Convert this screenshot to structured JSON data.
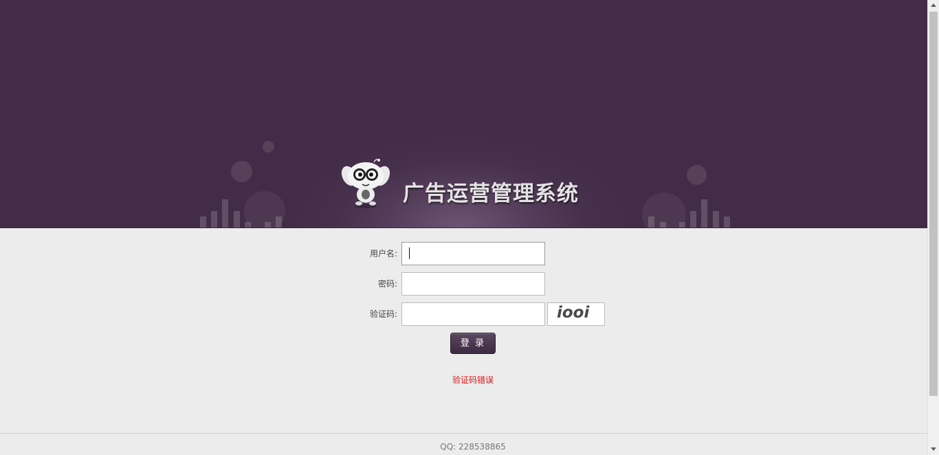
{
  "header": {
    "title": "广告运营管理系统",
    "logo_icon": "cartoon-mascot-icon"
  },
  "login_form": {
    "username_label": "用户名:",
    "username_value": "",
    "password_label": "密码:",
    "password_value": "",
    "captcha_label": "验证码:",
    "captcha_value": "",
    "captcha_image_text": "iooi",
    "login_button_label": "登 录",
    "error_message": "验证码错误"
  },
  "footer": {
    "text": "QQ: 228538865"
  },
  "colors": {
    "banner_bg": "#47304c",
    "page_bg": "#ececec",
    "error_text": "#e01010",
    "button_bg": "#4a3750"
  }
}
